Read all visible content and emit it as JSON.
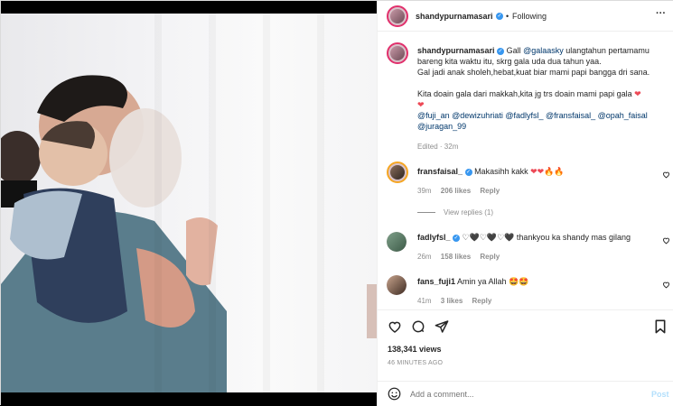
{
  "post": {
    "author": "shandypurnamasari",
    "follow_label": "Following",
    "dot": "•",
    "caption_mention": "@galaasky",
    "caption_line1_pre": "Gall",
    "caption_line1_post": "ulangtahun pertamamu",
    "caption_line2": "bareng kita waktu itu, skrg gala uda dua tahun yaa.",
    "caption_line3": "Gal jadi anak sholeh,hebat,kuat biar mami papi bangga dri sana.",
    "caption_line4": "Kita doain gala dari makkah,kita jg trs doain mami papi gala",
    "tags_line1": "@fuji_an @dewizuhriati @fadlyfsl_ @fransfaisal_ @opah_faisal",
    "tags_line2": "@juragan_99",
    "edited": "Edited · 32m"
  },
  "comments": [
    {
      "user": "fransfaisal_",
      "text": "Makasihh kakk",
      "emoji": "❤❤🔥🔥",
      "time": "39m",
      "likes": "206 likes",
      "reply": "Reply",
      "view_replies": "View replies (1)"
    },
    {
      "user": "fadlyfsl_",
      "emoji": "♡🖤♡🖤♡🖤",
      "text": "thankyou ka shandy mas gilang",
      "time": "26m",
      "likes": "158 likes",
      "reply": "Reply"
    },
    {
      "user": "fans_fuji1",
      "text": "Amin ya Allah",
      "emoji": "🤩🤩",
      "time": "41m",
      "likes": "3 likes",
      "reply": "Reply"
    }
  ],
  "stats": {
    "views": "138,341 views",
    "ago": "46 MINUTES AGO"
  },
  "composer": {
    "placeholder": "Add a comment...",
    "post_label": "Post"
  },
  "icons": [
    "more-icon",
    "heart-icon",
    "comment-icon",
    "share-icon",
    "bookmark-icon",
    "emoji-icon",
    "verified-icon"
  ],
  "colors": {
    "link": "#00376b",
    "muted": "#8e8e8e",
    "verified": "#3897f0",
    "post_btn": "#b2dffc"
  }
}
